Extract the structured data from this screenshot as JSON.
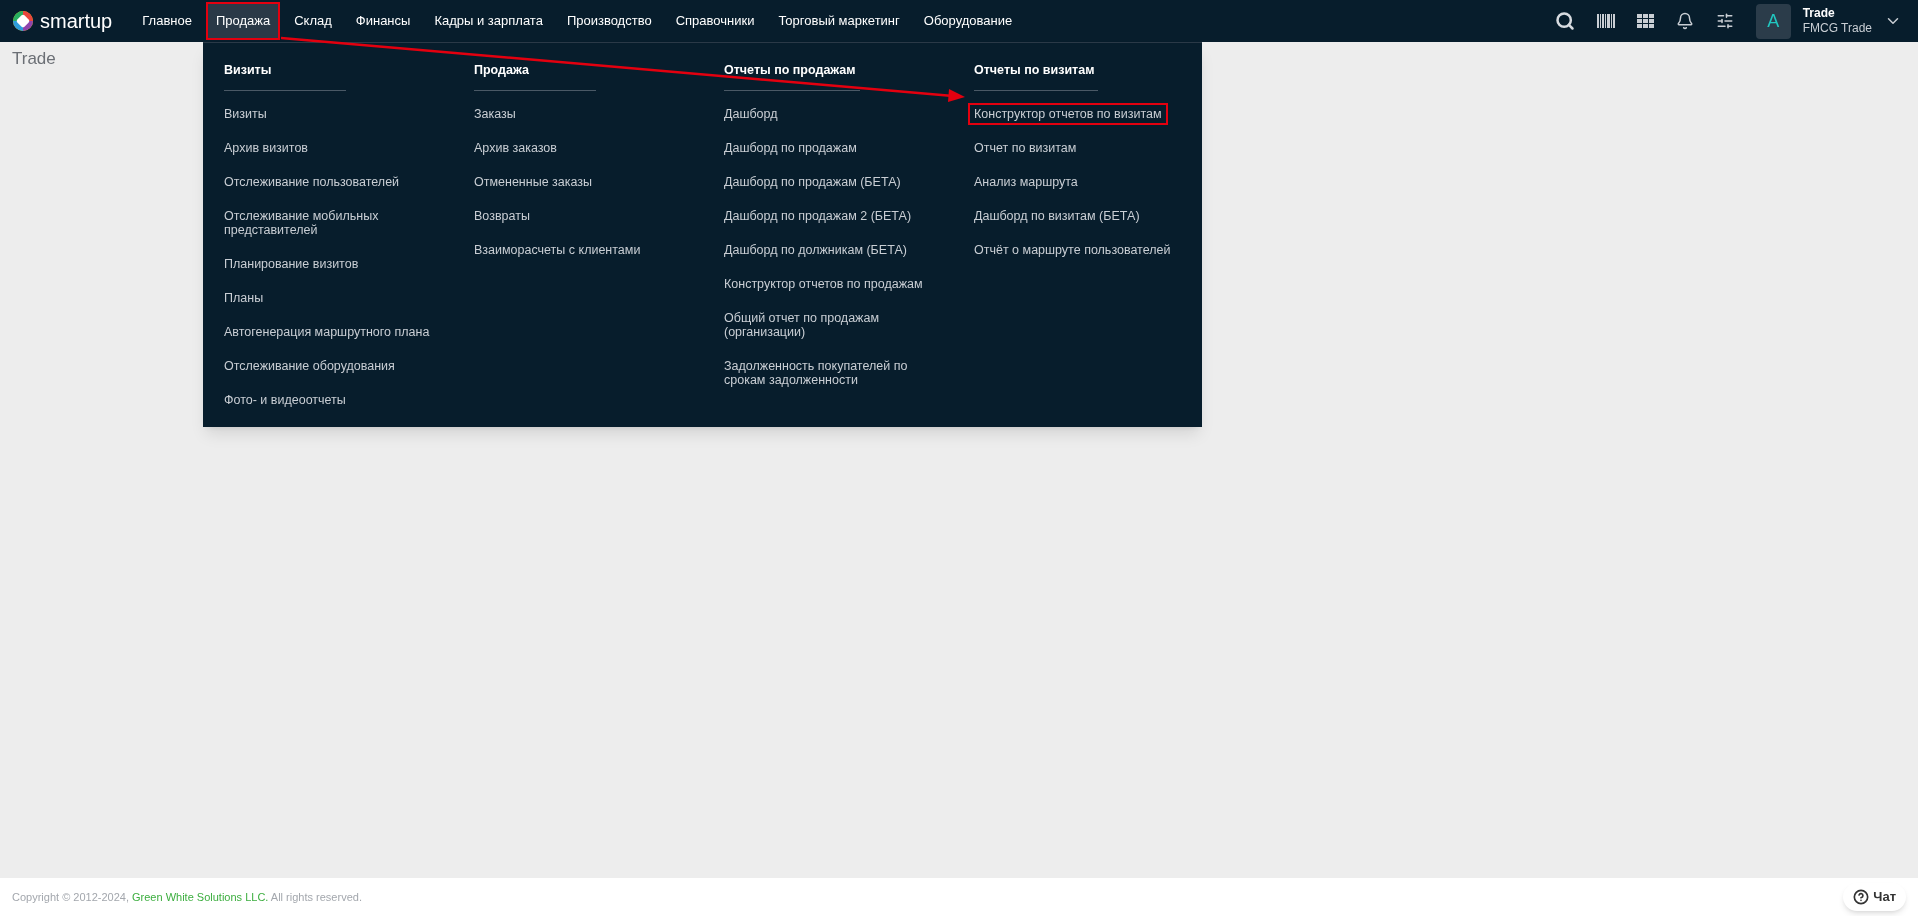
{
  "logo": {
    "text": "smartup"
  },
  "nav": [
    {
      "label": "Главное",
      "selected": false,
      "annotated": false
    },
    {
      "label": "Продажа",
      "selected": true,
      "annotated": true
    },
    {
      "label": "Склад",
      "selected": false,
      "annotated": false
    },
    {
      "label": "Финансы",
      "selected": false,
      "annotated": false
    },
    {
      "label": "Кадры и зарплата",
      "selected": false,
      "annotated": false
    },
    {
      "label": "Производство",
      "selected": false,
      "annotated": false
    },
    {
      "label": "Справочники",
      "selected": false,
      "annotated": false
    },
    {
      "label": "Торговый маркетинг",
      "selected": false,
      "annotated": false
    },
    {
      "label": "Оборудование",
      "selected": false,
      "annotated": false
    }
  ],
  "user": {
    "initial": "A",
    "name": "Trade",
    "company": "FMCG Trade"
  },
  "page_title": "Trade",
  "mega_menu": {
    "columns": [
      {
        "title": "Визиты",
        "items": [
          {
            "label": "Визиты",
            "annotated": false
          },
          {
            "label": "Архив визитов",
            "annotated": false
          },
          {
            "label": "Отслеживание пользователей",
            "annotated": false
          },
          {
            "label": "Отслеживание мобильных представителей",
            "annotated": false
          },
          {
            "label": "Планирование визитов",
            "annotated": false
          },
          {
            "label": "Планы",
            "annotated": false
          },
          {
            "label": "Автогенерация маршрутного плана",
            "annotated": false
          },
          {
            "label": "Отслеживание оборудования",
            "annotated": false
          },
          {
            "label": "Фото- и видеоотчеты",
            "annotated": false
          }
        ]
      },
      {
        "title": "Продажа",
        "items": [
          {
            "label": "Заказы",
            "annotated": false
          },
          {
            "label": "Архив заказов",
            "annotated": false
          },
          {
            "label": "Отмененные заказы",
            "annotated": false
          },
          {
            "label": "Возвраты",
            "annotated": false
          },
          {
            "label": "Взаиморасчеты с клиентами",
            "annotated": false
          }
        ]
      },
      {
        "title": "Отчеты по продажам",
        "items": [
          {
            "label": "Дашборд",
            "annotated": false
          },
          {
            "label": "Дашборд по продажам",
            "annotated": false
          },
          {
            "label": "Дашборд по продажам (БЕТА)",
            "annotated": false
          },
          {
            "label": "Дашборд по продажам 2 (БЕТА)",
            "annotated": false
          },
          {
            "label": "Дашборд по должникам (БЕТА)",
            "annotated": false
          },
          {
            "label": "Конструктор отчетов по продажам",
            "annotated": false
          },
          {
            "label": "Общий отчет по продажам (организации)",
            "annotated": false
          },
          {
            "label": "Задолженность покупателей по срокам задолженности",
            "annotated": false
          }
        ]
      },
      {
        "title": "Отчеты по визитам",
        "items": [
          {
            "label": "Конструктор отчетов по визитам",
            "annotated": true
          },
          {
            "label": "Отчет по визитам",
            "annotated": false
          },
          {
            "label": "Анализ маршрута",
            "annotated": false
          },
          {
            "label": "Дашборд по визитам (БЕТА)",
            "annotated": false
          },
          {
            "label": "Отчёт о маршруте пользователей",
            "annotated": false
          }
        ]
      }
    ]
  },
  "footer": {
    "copyright": "Copyright © 2012-2024,",
    "company_link": "Green White Solutions LLC.",
    "rights": "All rights reserved."
  },
  "chat_button": {
    "label": "Чат"
  }
}
